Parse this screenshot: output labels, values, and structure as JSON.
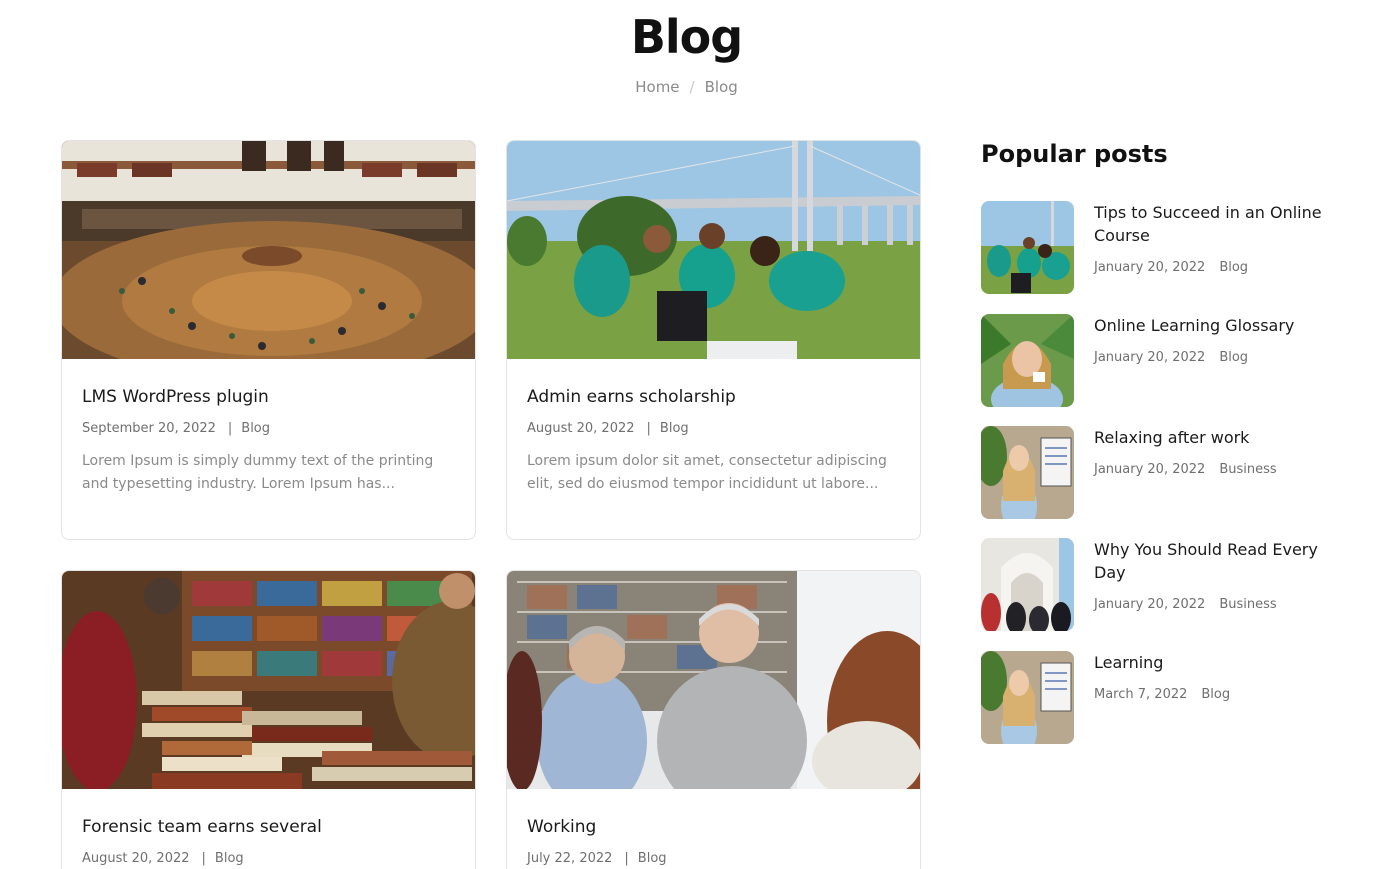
{
  "page": {
    "title": "Blog"
  },
  "breadcrumb": {
    "home": "Home",
    "separator": "/",
    "current": "Blog"
  },
  "posts": [
    {
      "title": "LMS WordPress plugin",
      "date": "September 20, 2022",
      "category": "Blog",
      "excerpt": "Lorem Ipsum is simply dummy text of the printing and typesetting industry. Lorem Ipsum has..."
    },
    {
      "title": "Admin earns scholarship",
      "date": "August 20, 2022",
      "category": "Blog",
      "excerpt": "Lorem ipsum dolor sit amet, consectetur adipiscing elit, sed do eiusmod tempor incididunt ut labore..."
    },
    {
      "title": "Forensic team earns several",
      "date": "August 20, 2022",
      "category": "Blog"
    },
    {
      "title": "Working",
      "date": "July 22, 2022",
      "category": "Blog"
    }
  ],
  "meta_separator": "|",
  "sidebar": {
    "title": "Popular posts",
    "items": [
      {
        "title": "Tips to Succeed in an Online Course",
        "date": "January 20, 2022",
        "category": "Blog"
      },
      {
        "title": "Online Learning Glossary",
        "date": "January 20, 2022",
        "category": "Blog"
      },
      {
        "title": "Relaxing after work",
        "date": "January 20, 2022",
        "category": "Business"
      },
      {
        "title": "Why You Should Read Every Day",
        "date": "January 20, 2022",
        "category": "Business"
      },
      {
        "title": "Learning",
        "date": "March 7, 2022",
        "category": "Blog"
      }
    ]
  }
}
